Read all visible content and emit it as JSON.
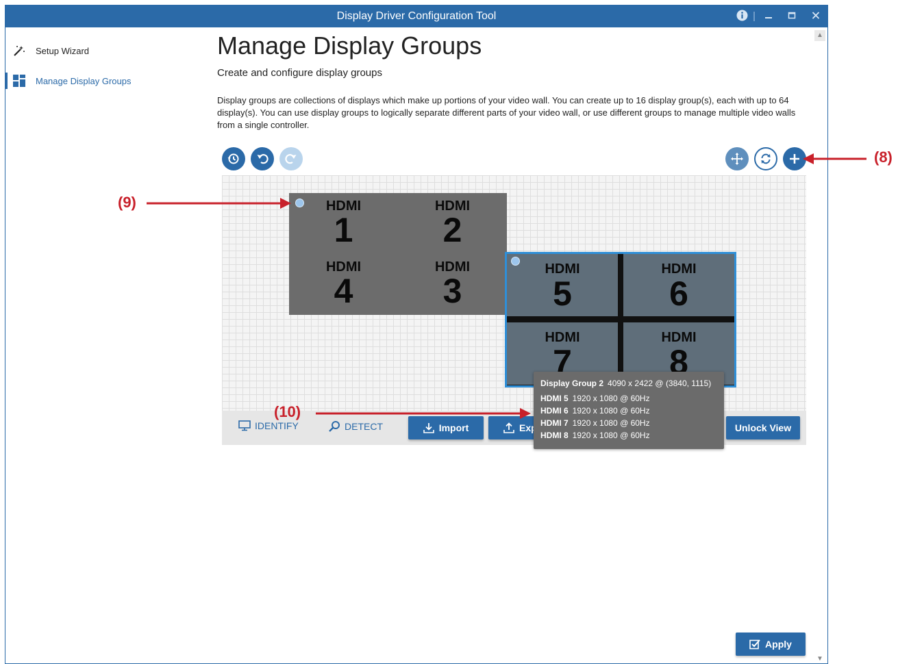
{
  "window": {
    "title": "Display Driver Configuration Tool"
  },
  "sidebar": {
    "items": [
      {
        "label": "Setup Wizard",
        "icon": "magic-wand-icon"
      },
      {
        "label": "Manage Display Groups",
        "icon": "grid-icon",
        "active": true
      }
    ]
  },
  "page": {
    "title": "Manage Display Groups",
    "subtitle": "Create and configure display groups",
    "description": "Display groups are collections of displays which make up portions of your video wall. You can create up to 16 display group(s), each with up to 64 display(s). You can use display groups to logically separate different parts of your video wall, or use different groups to manage multiple video walls from a single controller."
  },
  "groups": [
    {
      "tiles": [
        {
          "label": "HDMI",
          "num": "1"
        },
        {
          "label": "HDMI",
          "num": "2"
        },
        {
          "label": "HDMI",
          "num": "4"
        },
        {
          "label": "HDMI",
          "num": "3"
        }
      ]
    },
    {
      "tiles": [
        {
          "label": "HDMI",
          "num": "5"
        },
        {
          "label": "HDMI",
          "num": "6"
        },
        {
          "label": "HDMI",
          "num": "7"
        },
        {
          "label": "HDMI",
          "num": "8"
        }
      ]
    }
  ],
  "toolbar": {
    "identify": "IDENTIFY",
    "detect": "DETECT",
    "import": "Import",
    "export": "Exp",
    "unlock": "Unlock View"
  },
  "tooltip": {
    "group_name": "Display Group 2",
    "group_info": "4090 x 2422 @ (3840, 1115)",
    "rows": [
      {
        "name": "HDMI 5",
        "spec": "1920 x 1080 @ 60Hz"
      },
      {
        "name": "HDMI 6",
        "spec": "1920 x 1080 @ 60Hz"
      },
      {
        "name": "HDMI 7",
        "spec": "1920 x 1080 @ 60Hz"
      },
      {
        "name": "HDMI 8",
        "spec": "1920 x 1080 @ 60Hz"
      }
    ]
  },
  "apply": "Apply",
  "callouts": {
    "c8": "(8)",
    "c9": "(9)",
    "c10": "(10)"
  },
  "colors": {
    "accent": "#2b6aa8",
    "selection": "#2f8fd8",
    "callout": "#c8202a"
  }
}
